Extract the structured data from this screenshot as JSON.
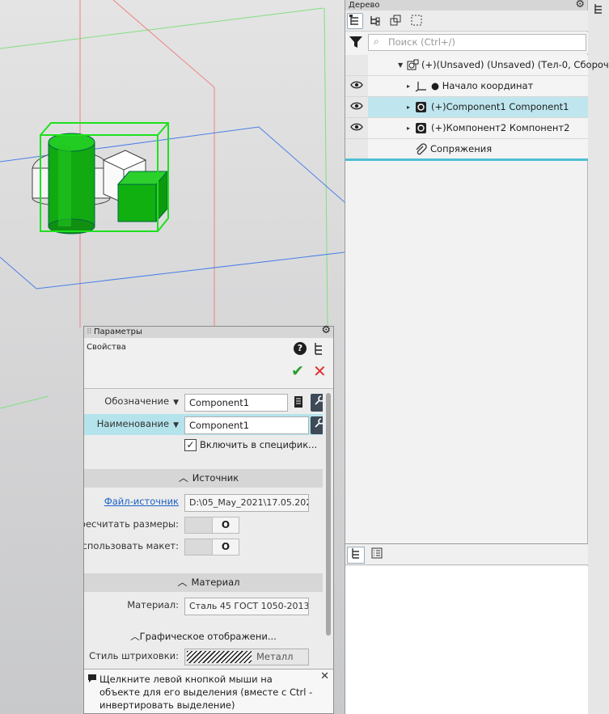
{
  "tree_panel": {
    "title": "Дерево",
    "search_placeholder": "Поиск (Ctrl+/)",
    "rows": [
      {
        "label": "(Unsaved) (Unsaved) (Тел-0, Сбороч",
        "prefix": "(+)",
        "expanded": true,
        "eye": false
      },
      {
        "label": "Начало координат",
        "prefix": "●",
        "expanded": false,
        "eye": true
      },
      {
        "label": "Component1 Component1",
        "prefix": "(+)",
        "expanded": false,
        "eye": true,
        "selected": true
      },
      {
        "label": "Компонент2 Компонент2",
        "prefix": "(+)",
        "expanded": false,
        "eye": true
      },
      {
        "label": "Сопряжения",
        "prefix": "",
        "expanded": false,
        "eye": false
      }
    ],
    "selection_color": "#bfe6ee"
  },
  "params_panel": {
    "title": "Параметры",
    "subtitle": "Свойства",
    "designation_label": "Обозначение",
    "designation_value": "Component1",
    "name_label": "Наименование",
    "name_value": "Component1",
    "include_spec_label": "Включить в специфик...",
    "include_spec_checked": true,
    "source_section": "Источник",
    "source_file_label": "Файл-источник",
    "source_file_value": "D:\\05_May_2021\\17.05.202...",
    "recalc_label": "Пересчитать размеры:",
    "use_layout_label": "Использовать макет:",
    "toggle_state": "O",
    "material_section": "Материал",
    "material_label": "Материал:",
    "material_value": "Сталь 45  ГОСТ 1050-2013",
    "graphics_section": "Графическое отображени...",
    "hatch_label": "Стиль штриховки:",
    "hatch_value": "Металл",
    "hint_text": "Щелкните левой кнопкой мыши на объекте для его выделения (вместе с Ctrl - инвертировать выделение)"
  },
  "colors": {
    "accent_highlight": "#b5e3ec",
    "ok_green": "#2aa02a",
    "cancel_red": "#e23030",
    "selection_green": "#1ee01e"
  },
  "icons": [
    "gear-icon",
    "funnel-icon",
    "search-icon",
    "eye-icon",
    "help-icon",
    "check-icon",
    "close-icon",
    "library-icon",
    "edit-tool-icon",
    "paperclip-icon"
  ]
}
